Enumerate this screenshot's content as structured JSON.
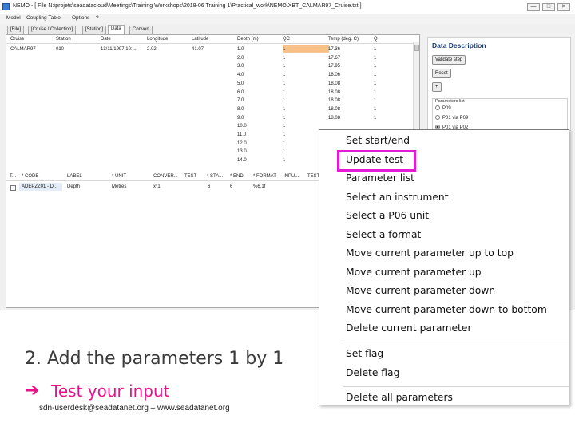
{
  "window": {
    "title": "NEMO - [ File N:\\projets\\seadatacloud\\Meetings\\Training Workshops\\2018-06 Training 1\\Practical_work\\NEMO\\XBT_CALMAR97_Cruise.txt ]",
    "minimize": "—",
    "maximize": "□",
    "close": "✕"
  },
  "menu": [
    "Model",
    "Coupling Table",
    "Options",
    "?"
  ],
  "tabs": [
    "[File]",
    "[Cruise / Collection]",
    "[Station]",
    "Data",
    "Convert"
  ],
  "data_table": {
    "headers": [
      "Cruise",
      "Station",
      "Date",
      "Longitude",
      "Latitude",
      "Depth (m)",
      "QC",
      "Temp (deg. C)",
      "Q"
    ],
    "first_row": [
      "CALMAR97",
      "010",
      "13/11/1997 10:...",
      "2.02",
      "41.07"
    ],
    "depths": [
      "1.0",
      "2.0",
      "3.0",
      "4.0",
      "5.0",
      "6.0",
      "7.0",
      "8.0",
      "9.0",
      "10.0",
      "11.0",
      "12.0",
      "13.0",
      "14.0"
    ],
    "qc": [
      "1",
      "1",
      "1",
      "1",
      "1",
      "1",
      "1",
      "1",
      "1",
      "1",
      "1",
      "1",
      "1",
      "1"
    ],
    "temps": [
      "17.36",
      "17.67",
      "17.95",
      "18.06",
      "18.08",
      "18.08",
      "18.08",
      "18.08",
      "18.08"
    ],
    "q": [
      "1",
      "1",
      "1",
      "1",
      "1",
      "1",
      "1",
      "1",
      "1"
    ]
  },
  "params_table": {
    "headers": [
      "T...",
      "* CODE",
      "LABEL",
      "* UNIT",
      "CONVER...",
      "TEST",
      "* STA...",
      "* END",
      "* FORMAT",
      "INPU...",
      "TEST"
    ],
    "row": [
      "ADEPZZ01 - D...",
      "Depth",
      "Metres",
      "x*1",
      "6",
      "6",
      "%6.1f"
    ]
  },
  "side_panel": {
    "title": "Data Description",
    "validate_button": "Validate step",
    "reset_button": "Reset",
    "add_button": "+",
    "params_label": "Parameters list",
    "radios": [
      "P09",
      "P01 via P09",
      "P01 via P02"
    ]
  },
  "context_menu": {
    "group1": [
      "Set start/end",
      "Update test",
      "Parameter list",
      "Select an instrument",
      "Select a P06 unit",
      "Select a format",
      "Move current parameter up to top",
      "Move current parameter up",
      "Move current parameter down",
      "Move current parameter down to bottom",
      "Delete current parameter"
    ],
    "group2": [
      "Set flag",
      "Delete flag"
    ],
    "group3": [
      "Delete all parameters"
    ],
    "highlight_color": "#e619d9"
  },
  "slide": {
    "step_text": "2. Add the parameters 1 by 1",
    "arrow": "➔",
    "action_text": "Test your input",
    "footer": "sdn-userdesk@seadatanet.org – www.seadatanet.org",
    "accent_color": "#e8118c"
  }
}
